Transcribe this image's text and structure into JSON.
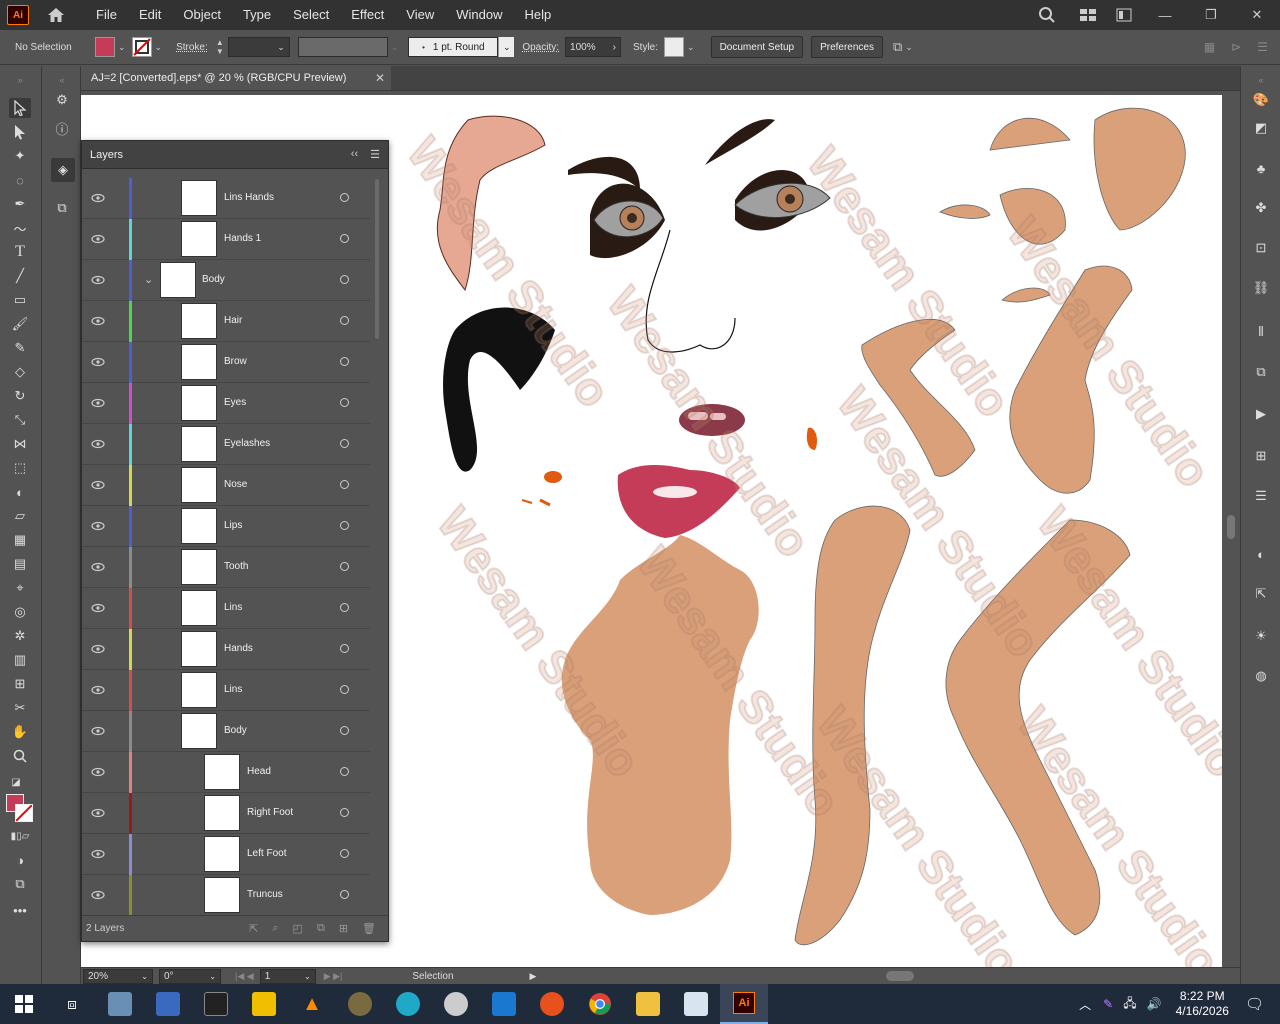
{
  "app": {
    "logo": "Ai",
    "title_tab": "AJ=2  [Converted].eps* @ 20 % (RGB/CPU Preview)"
  },
  "menu": [
    "File",
    "Edit",
    "Object",
    "Type",
    "Select",
    "Effect",
    "View",
    "Window",
    "Help"
  ],
  "control": {
    "selection": "No Selection",
    "stroke_label": "Stroke:",
    "brush": "1 pt. Round",
    "opacity_label": "Opacity:",
    "opacity_value": "100%",
    "style_label": "Style:",
    "doc_setup": "Document Setup",
    "preferences": "Preferences"
  },
  "colors": {
    "fill": "#c43c58",
    "accent": "#ff7c00",
    "taskbar": "#1f2a3a"
  },
  "layers_panel": {
    "title": "Layers",
    "footer": "2 Layers",
    "rows": [
      {
        "name": "Lins Hands",
        "color": "#4b5fd6",
        "level": 1
      },
      {
        "name": "Hands 1",
        "color": "#5ad6d6",
        "level": 1
      },
      {
        "name": "Body",
        "color": "#4b5fd6",
        "level": 0
      },
      {
        "name": "Hair",
        "color": "#4bd64b",
        "level": 1
      },
      {
        "name": "Brow",
        "color": "#4b5fd6",
        "level": 1
      },
      {
        "name": "Eyes",
        "color": "#d64bd6",
        "level": 1
      },
      {
        "name": "Eyelashes",
        "color": "#5ad6d6",
        "level": 1
      },
      {
        "name": "Nose",
        "color": "#d6d64b",
        "level": 1
      },
      {
        "name": "Lips",
        "color": "#4b5fd6",
        "level": 1
      },
      {
        "name": "Tooth",
        "color": "#8c8c8c",
        "level": 1
      },
      {
        "name": "Lins",
        "color": "#d64b4b",
        "level": 1
      },
      {
        "name": "Hands",
        "color": "#d6d64b",
        "level": 1
      },
      {
        "name": "Lins",
        "color": "#d64b4b",
        "level": 1
      },
      {
        "name": "Body",
        "color": "#8c8c8c",
        "level": 1
      },
      {
        "name": "Head",
        "color": "#e08080",
        "level": 2
      },
      {
        "name": "Right Foot",
        "color": "#a01818",
        "level": 2
      },
      {
        "name": "Left Foot",
        "color": "#8c8cd6",
        "level": 2
      },
      {
        "name": "Truncus",
        "color": "#8c8c32",
        "level": 2
      }
    ]
  },
  "status": {
    "zoom": "20%",
    "rotation": "0°",
    "artboard": "1",
    "tool": "Selection"
  },
  "watermark": "Wesam Studio",
  "taskbar": {
    "time": "8:22 PM",
    "date": "4/16/2026"
  }
}
